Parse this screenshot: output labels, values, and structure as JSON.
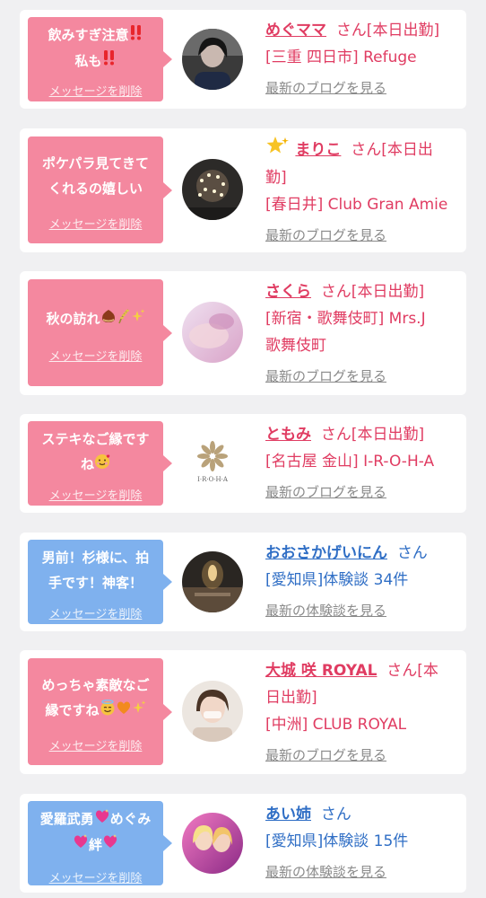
{
  "cards": [
    {
      "message": [
        "飲みすぎ注意",
        "私も"
      ],
      "delete_label": "メッセージを削除",
      "name": "めぐママ",
      "suffix": "さん[本日出勤]",
      "shop": "[三重 四日市] Refuge",
      "link": "最新のブログを見る"
    },
    {
      "message": [
        "ポケパラ見てきて",
        "くれるの嬉しい"
      ],
      "delete_label": "メッセージを削除",
      "name": "まりこ",
      "suffix": "さん[本日出",
      "suffix2": "勤]",
      "shop": "[春日井] Club Gran Amie",
      "link": "最新のブログを見る"
    },
    {
      "message": [
        "秋の訪れ"
      ],
      "delete_label": "メッセージを削除",
      "name": "さくら",
      "suffix": "さん[本日出勤]",
      "shop": "[新宿・歌舞伎町] Mrs.J",
      "shop2": "歌舞伎町",
      "link": "最新のブログを見る"
    },
    {
      "message": [
        "ステキなご縁です",
        "ね"
      ],
      "delete_label": "メッセージを削除",
      "name": "ともみ",
      "suffix": "さん[本日出勤]",
      "shop": "[名古屋 金山] I-R-O-H-A",
      "link": "最新のブログを見る",
      "logo_text": "I·R·O·H·A"
    },
    {
      "message": [
        "男前！杉様に、拍",
        "手です！神客！"
      ],
      "delete_label": "メッセージを削除",
      "name": "おおさかげいにん",
      "suffix": "さん",
      "shop": "[愛知県]体験談 34件",
      "link": "最新の体験談を見る"
    },
    {
      "message": [
        "めっちゃ素敵なご",
        "縁ですね"
      ],
      "delete_label": "メッセージを削除",
      "name": "大城 咲 ROYAL",
      "suffix": "さん[本",
      "suffix2": "日出勤]",
      "shop": "[中洲] CLUB ROYAL",
      "link": "最新のブログを見る"
    },
    {
      "message": [
        "愛羅武勇",
        "めぐみ",
        "絆"
      ],
      "delete_label": "メッセージを削除",
      "name": "あい姉",
      "suffix": "さん",
      "shop": "[愛知県]体験談 15件",
      "link": "最新の体験談を見る"
    }
  ],
  "colors": {
    "pink_bubble": "#f4889f",
    "blue_bubble": "#7fb1ee",
    "name_pink": "#e03c62",
    "name_blue": "#2f6ec5",
    "link_gray": "#8a8a8a"
  },
  "icons": [
    "double-exclamation-icon",
    "star-icon",
    "chestnut-icon",
    "rice-ear-icon",
    "sparkles-icon",
    "smiling-face-hearts-icon",
    "halo-face-icon",
    "orange-heart-icon",
    "sparkling-heart-icon"
  ]
}
